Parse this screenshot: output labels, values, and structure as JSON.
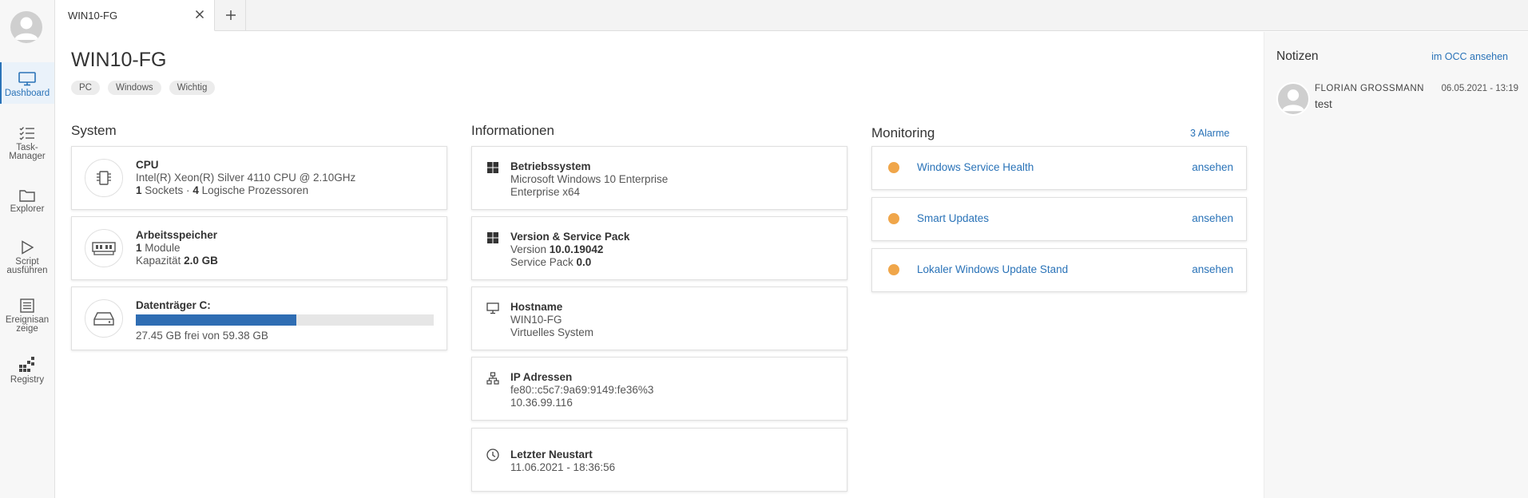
{
  "nav": {
    "items": [
      {
        "label": "Dashboard",
        "icon": "monitor-icon",
        "active": true
      },
      {
        "label": "Task-\nManager",
        "icon": "task-list-icon"
      },
      {
        "label": "Explorer",
        "icon": "folder-icon"
      },
      {
        "label": "Script ausführen",
        "icon": "play-icon"
      },
      {
        "label": "Ereignisan zeige",
        "icon": "event-log-icon"
      },
      {
        "label": "Registry",
        "icon": "registry-icon"
      }
    ]
  },
  "tabs": {
    "active_label": "WIN10-FG"
  },
  "header": {
    "title": "WIN10-FG",
    "tags": [
      "PC",
      "Windows",
      "Wichtig"
    ]
  },
  "system": {
    "title": "System",
    "cpu": {
      "title": "CPU",
      "model": "Intel(R) Xeon(R) Silver 4110 CPU @ 2.10GHz",
      "sockets": "1",
      "sockets_label": "Sockets ·",
      "cores": "4",
      "cores_label": "Logische Prozessoren"
    },
    "memory": {
      "title": "Arbeitsspeicher",
      "modules": "1",
      "modules_label": "Module",
      "capacity_label": "Kapazität",
      "capacity": "2.0 GB"
    },
    "disk": {
      "title": "Datenträger C:",
      "used_fraction": 0.538,
      "summary": "27.45 GB frei von 59.38 GB"
    }
  },
  "info": {
    "title": "Informationen",
    "os": {
      "title": "Betriebssystem",
      "line1": "Microsoft Windows 10 Enterprise",
      "line2": "Enterprise x64"
    },
    "version": {
      "title": "Version & Service Pack",
      "version_label": "Version",
      "version": "10.0.19042",
      "sp_label": "Service Pack",
      "sp": "0.0"
    },
    "hostname": {
      "title": "Hostname",
      "line1": "WIN10-FG",
      "line2": "Virtuelles System"
    },
    "ip": {
      "title": "IP Adressen",
      "line1": "fe80::c5c7:9a69:9149:fe36%3",
      "line2": "10.36.99.116"
    },
    "restart": {
      "title": "Letzter Neustart",
      "line1": "11.06.2021 - 18:36:56"
    }
  },
  "monitoring": {
    "title": "Monitoring",
    "alarms_link": "3 Alarme",
    "status_color": "#f0a64a",
    "items": [
      {
        "label": "Windows Service Health",
        "link": "ansehen"
      },
      {
        "label": "Smart Updates",
        "link": "ansehen"
      },
      {
        "label": "Lokaler Windows Update Stand",
        "link": "ansehen"
      }
    ]
  },
  "notes": {
    "title": "Notizen",
    "occ_link": "im OCC ansehen",
    "entries": [
      {
        "author": "FLORIAN GROSSMANN",
        "date": "06.05.2021 - 13:19",
        "text": "test"
      }
    ]
  }
}
